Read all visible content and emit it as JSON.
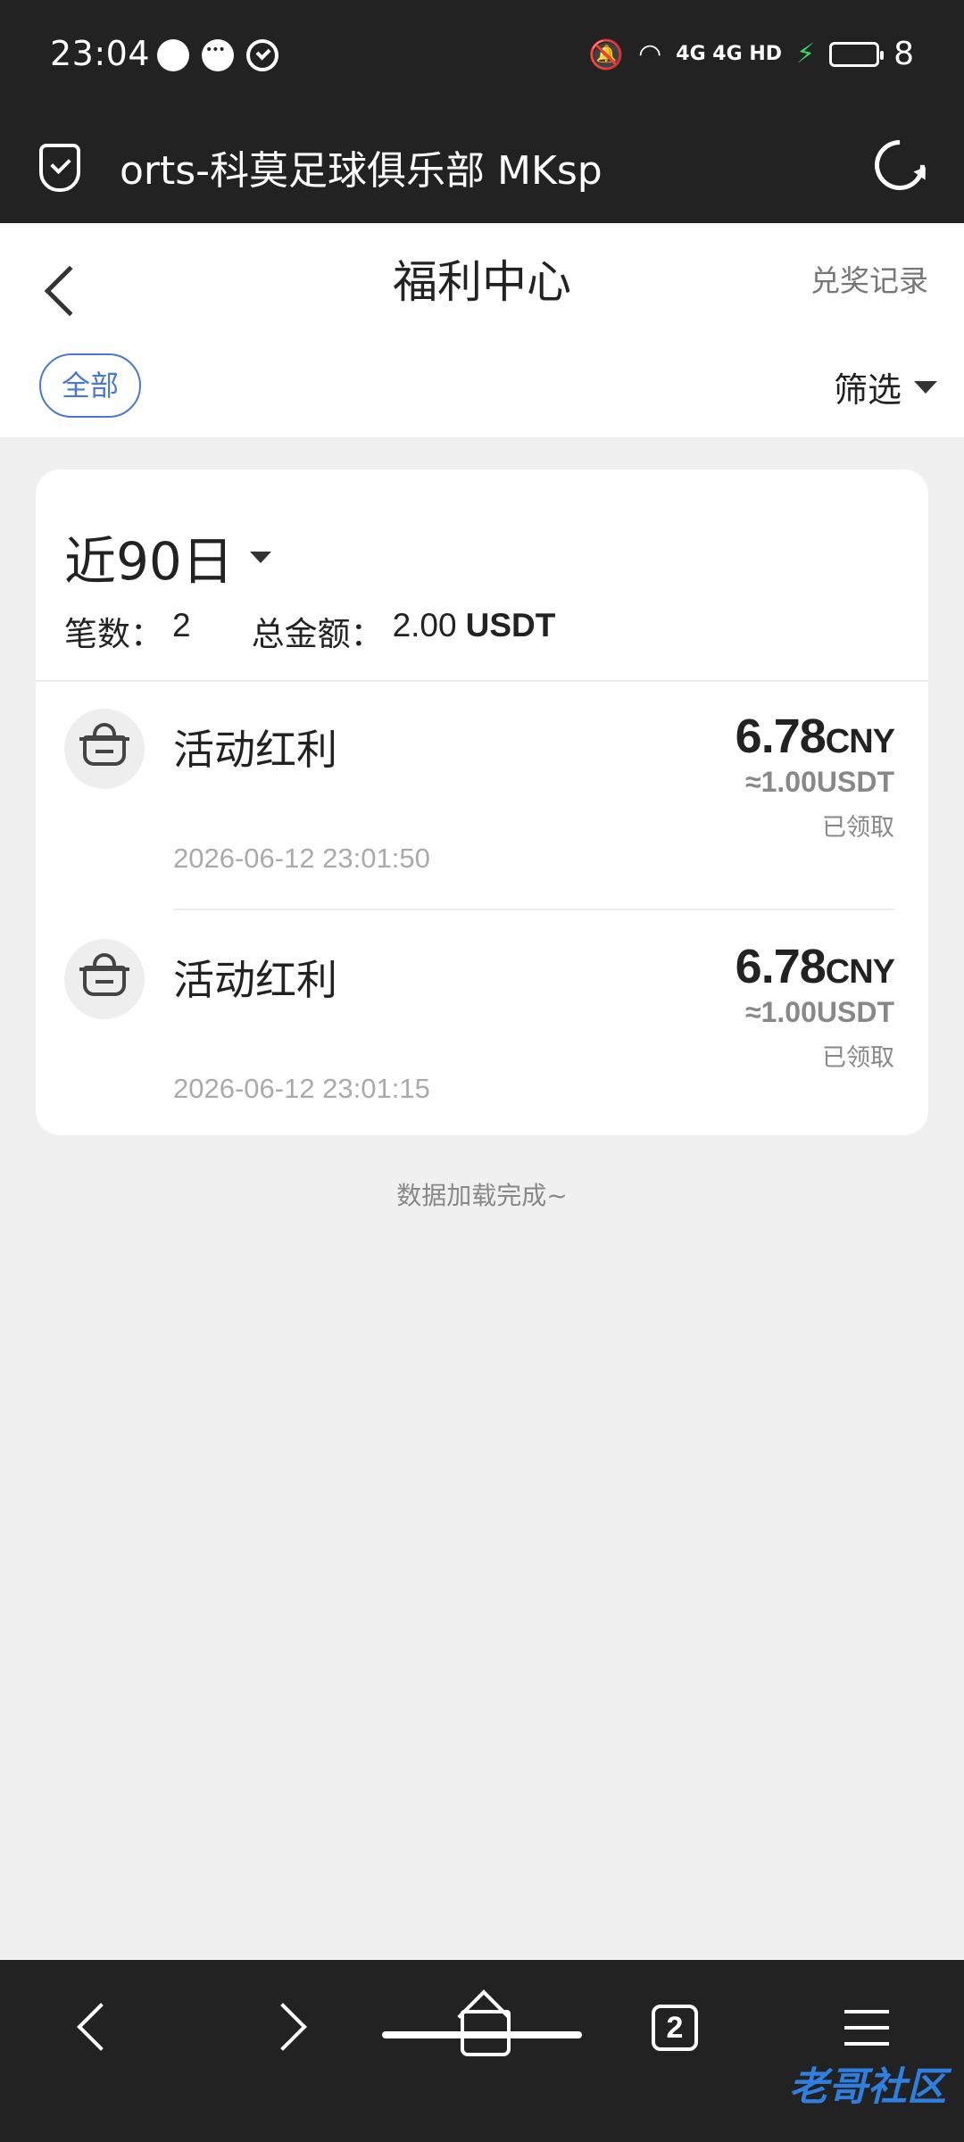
{
  "status_bar": {
    "time": "23:04",
    "network": "4G 4G HD",
    "battery": "8"
  },
  "browser": {
    "url": "orts-科莫足球俱乐部   MKsp"
  },
  "header": {
    "title": "福利中心",
    "right_link": "兑奖记录"
  },
  "filters": {
    "tab_all": "全部",
    "filter_label": "筛选"
  },
  "summary": {
    "period": "近90日",
    "count_label": "笔数：",
    "count_value": "2",
    "total_label": "总金额：",
    "total_value": "2.00",
    "total_unit": "USDT"
  },
  "records": [
    {
      "title": "活动红利",
      "amount": "6.78",
      "currency": "CNY",
      "approx": "≈1.00USDT",
      "status": "已领取",
      "time": "2026-06-12 23:01:50",
      "icon": "gift-icon"
    },
    {
      "title": "活动红利",
      "amount": "6.78",
      "currency": "CNY",
      "approx": "≈1.00USDT",
      "status": "已领取",
      "time": "2026-06-12 23:01:15",
      "icon": "gift-icon"
    }
  ],
  "footer": {
    "loaded_text": "数据加载完成~"
  },
  "bottom_nav": {
    "tabs_count": "2"
  },
  "watermark": {
    "text": "老哥社区"
  },
  "colors": {
    "accent": "#4a78d0",
    "dark_bar": "#222222",
    "background": "#f0f0f0"
  }
}
